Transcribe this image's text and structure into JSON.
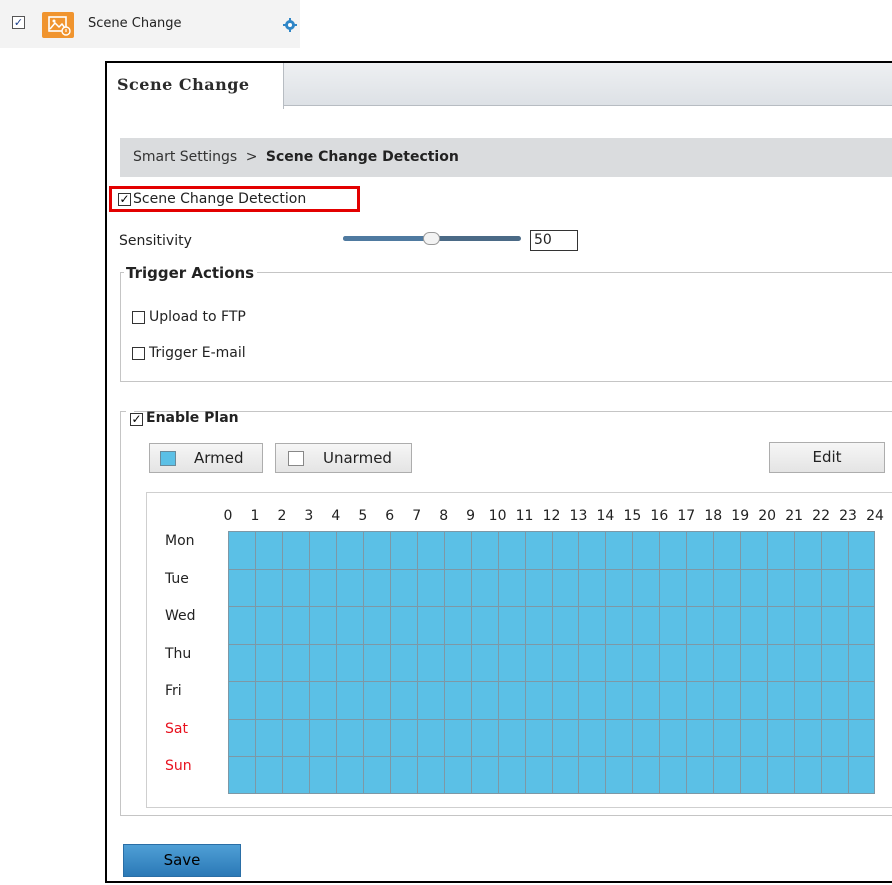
{
  "top_item": {
    "checked": true,
    "label": "Scene Change",
    "icon": "image-alert-icon",
    "settings_icon": "gear-icon"
  },
  "window": {
    "tab_label": "Scene Change",
    "breadcrumb": {
      "parent": "Smart Settings",
      "separator": ">",
      "current": "Scene Change Detection"
    },
    "enable_checkbox": {
      "label": "Scene Change Detection",
      "checked": true
    },
    "sensitivity": {
      "label": "Sensitivity",
      "value": "50",
      "level_fraction": 0.5
    },
    "trigger_actions": {
      "title": "Trigger Actions",
      "options": [
        {
          "label": "Upload to FTP",
          "checked": false
        },
        {
          "label": "Trigger E-mail",
          "checked": false
        }
      ]
    },
    "plan": {
      "title": "Enable Plan",
      "checked": true,
      "armed_label": "Armed",
      "unarmed_label": "Unarmed",
      "edit_label": "Edit",
      "armed_color": "#5bc0e6",
      "hours": [
        "0",
        "1",
        "2",
        "3",
        "4",
        "5",
        "6",
        "7",
        "8",
        "9",
        "10",
        "11",
        "12",
        "13",
        "14",
        "15",
        "16",
        "17",
        "18",
        "19",
        "20",
        "21",
        "22",
        "23",
        "24"
      ],
      "days": [
        {
          "label": "Mon",
          "weekend": false
        },
        {
          "label": "Tue",
          "weekend": false
        },
        {
          "label": "Wed",
          "weekend": false
        },
        {
          "label": "Thu",
          "weekend": false
        },
        {
          "label": "Fri",
          "weekend": false
        },
        {
          "label": "Sat",
          "weekend": true
        },
        {
          "label": "Sun",
          "weekend": true
        }
      ]
    },
    "save_label": "Save"
  }
}
